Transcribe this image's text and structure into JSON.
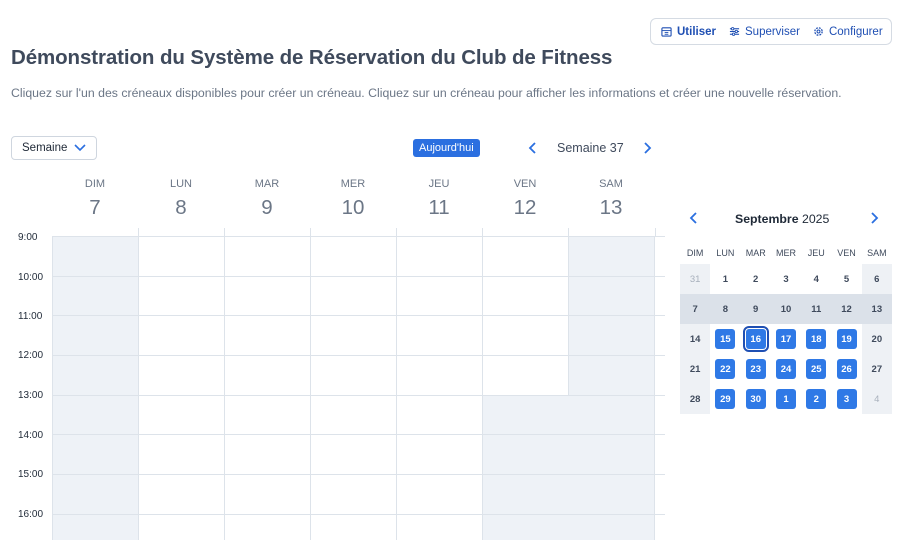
{
  "modes": [
    {
      "label": "Utiliser",
      "icon": "calendar-icon",
      "active": true
    },
    {
      "label": "Superviser",
      "icon": "sliders-icon",
      "active": false
    },
    {
      "label": "Configurer",
      "icon": "gear-icon",
      "active": false
    }
  ],
  "title": "Démonstration du Système de Réservation du Club de Fitness",
  "subtitle": "Cliquez sur l'un des créneaux disponibles pour créer un créneau. Cliquez sur un créneau pour afficher les informations et créer une nouvelle réservation.",
  "toolbar": {
    "view_select": "Semaine",
    "today_label": "Aujourd'hui",
    "week_label": "Semaine 37"
  },
  "week": {
    "days": [
      {
        "name": "DIM",
        "date": "7"
      },
      {
        "name": "LUN",
        "date": "8"
      },
      {
        "name": "MAR",
        "date": "9"
      },
      {
        "name": "MER",
        "date": "10"
      },
      {
        "name": "JEU",
        "date": "11"
      },
      {
        "name": "VEN",
        "date": "12"
      },
      {
        "name": "SAM",
        "date": "13"
      }
    ],
    "times": [
      "9:00",
      "10:00",
      "11:00",
      "12:00",
      "13:00",
      "14:00",
      "15:00",
      "16:00"
    ]
  },
  "mini_calendar": {
    "month": "Septembre",
    "year": "2025",
    "weekdays": [
      "DIM",
      "LUN",
      "MAR",
      "MER",
      "JEU",
      "VEN",
      "SAM"
    ],
    "weeks": [
      [
        "31",
        "1",
        "2",
        "3",
        "4",
        "5",
        "6"
      ],
      [
        "7",
        "8",
        "9",
        "10",
        "11",
        "12",
        "13"
      ],
      [
        "14",
        "15",
        "16",
        "17",
        "18",
        "19",
        "20"
      ],
      [
        "21",
        "22",
        "23",
        "24",
        "25",
        "26",
        "27"
      ],
      [
        "28",
        "29",
        "30",
        "1",
        "2",
        "3",
        "4"
      ]
    ]
  },
  "colors": {
    "accent": "#2b6fe0",
    "available_day": "#2f79e6",
    "shaded": "#eef2f7"
  }
}
